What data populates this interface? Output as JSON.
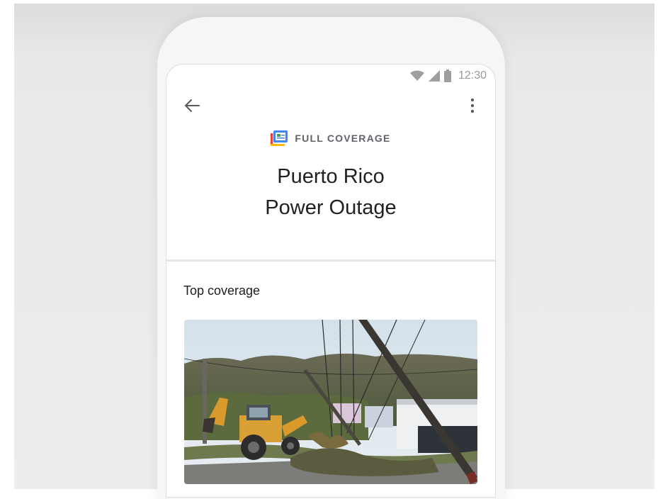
{
  "status_bar": {
    "time": "12:30",
    "icons": [
      "wifi-icon",
      "signal-icon",
      "battery-icon"
    ]
  },
  "app_bar": {
    "back_icon": "arrow-back-icon",
    "menu_icon": "more-vert-icon"
  },
  "header": {
    "badge_icon": "full-coverage-icon",
    "badge_label": "FULL COVERAGE",
    "title_line1": "Puerto Rico",
    "title_line2": "Power Outage"
  },
  "section": {
    "title": "Top coverage"
  },
  "colors": {
    "accent_blue": "#4285f4",
    "accent_red": "#ea4335",
    "accent_yellow": "#fbbc05",
    "accent_green": "#34a853",
    "text_primary": "#202124",
    "text_secondary": "#5f6368"
  }
}
